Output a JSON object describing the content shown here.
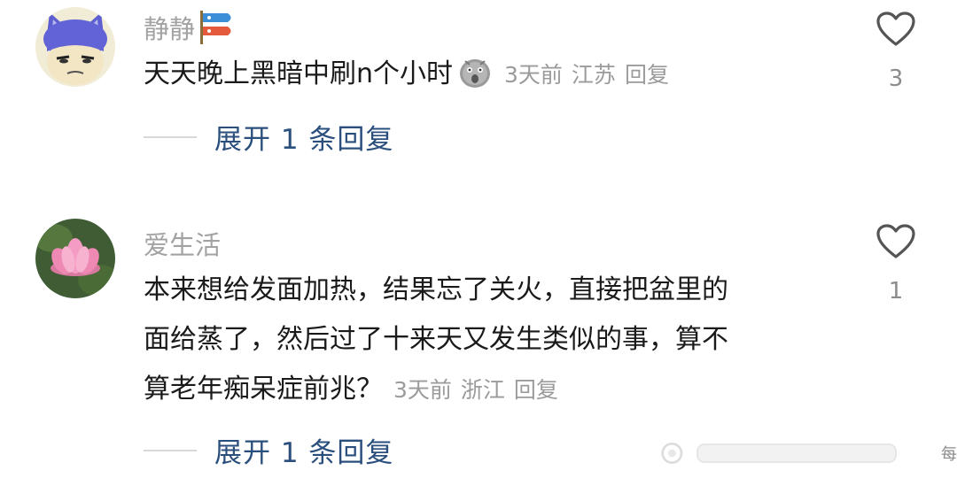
{
  "comments": [
    {
      "username": "静静",
      "badge_icon": "koi-flag-icon",
      "text": "天天晚上黑暗中刷n个小时",
      "emoji_icon": "shocked-face-emoji",
      "time": "3天前",
      "location": "江苏",
      "reply_label": "回复",
      "like_icon": "heart-outline-icon",
      "likes": "3",
      "expand_label": "展开 1 条回复"
    },
    {
      "username": "爱生活",
      "text_lines": [
        "本来想给发面加热，结果忘了关火，直接把盆里的",
        "面给蒸了，然后过了十来天又发生类似的事，算不",
        "算老年痴呆症前兆？"
      ],
      "time": "3天前",
      "location": "浙江",
      "reply_label": "回复",
      "like_icon": "heart-outline-icon",
      "likes": "1",
      "expand_label": "展开 1 条回复"
    }
  ],
  "watermark": {
    "text": "每"
  },
  "colors": {
    "username": "#a2a2a2",
    "content": "#1a1a1a",
    "meta": "#9b9b9b",
    "expand_link": "#2a4f7d"
  }
}
